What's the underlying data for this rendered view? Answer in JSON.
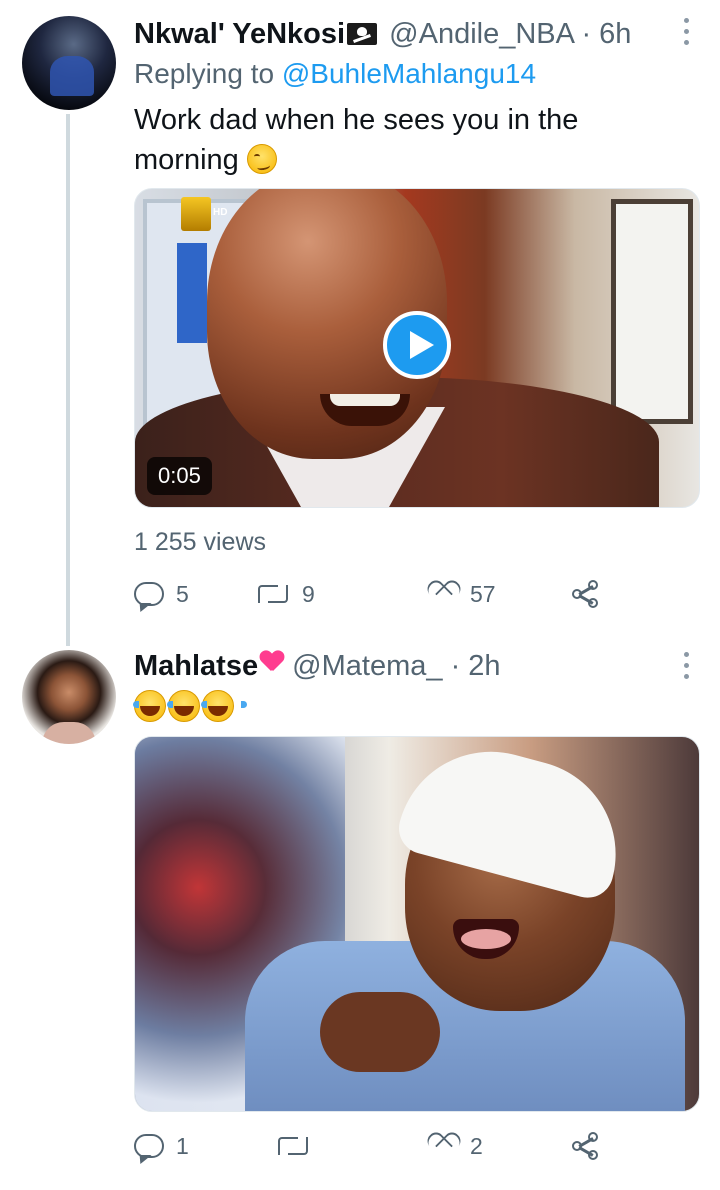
{
  "tweets": [
    {
      "name": "Nkwal' YeNkosi",
      "handle": "@Andile_NBA",
      "separator": "·",
      "time": "6h",
      "replying_prefix": "Replying to",
      "replying_to": "@BuhleMahlangu14",
      "text": "Work dad when he sees you in the morning",
      "text_emoji": "smirking-face",
      "media_type": "video",
      "video_duration": "0:05",
      "views": "1 255 views",
      "replies": "5",
      "retweets": "9",
      "likes": "57"
    },
    {
      "name": "Mahlatse",
      "name_emoji": "two-hearts",
      "handle": "@Matema_",
      "separator": "·",
      "time": "2h",
      "text_emoji": "face-with-tears-of-joy x3",
      "media_type": "photo",
      "replies": "1",
      "retweets": "",
      "likes": "2"
    }
  ],
  "colors": {
    "accent": "#1d9bf0",
    "secondary_text": "#536471",
    "thread_line": "#cfd9de"
  }
}
